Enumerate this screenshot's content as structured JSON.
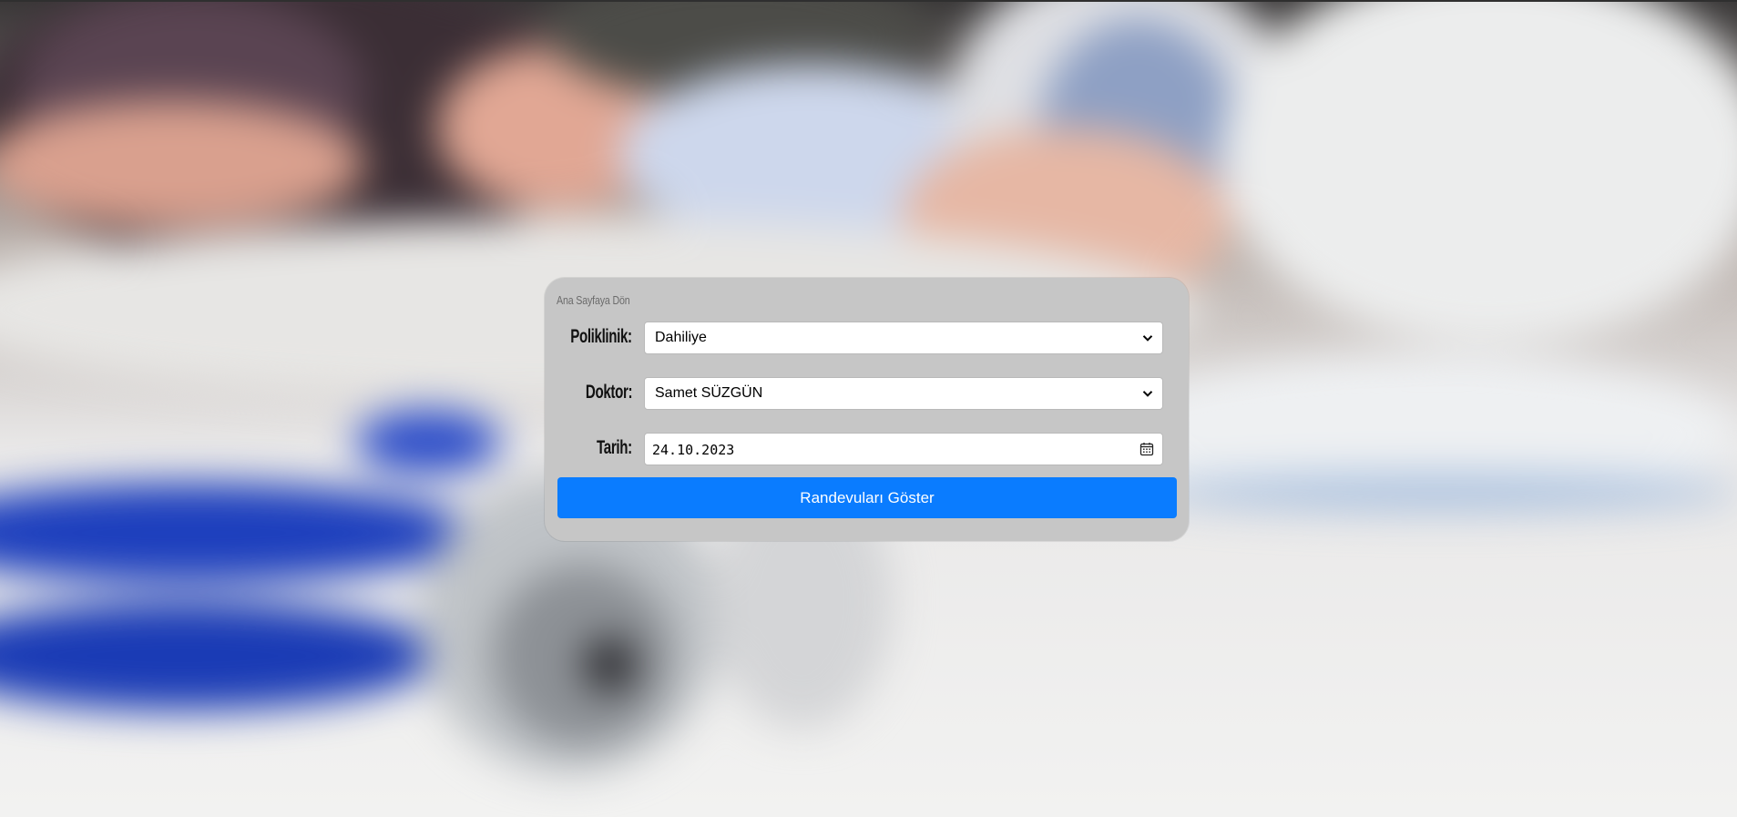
{
  "page": {
    "back_link": "Ana Sayfaya Dön"
  },
  "form": {
    "poliklinik": {
      "label": "Poliklinik:",
      "value": "Dahiliye"
    },
    "doktor": {
      "label": "Doktor:",
      "value": "Samet SÜZGÜN"
    },
    "tarih": {
      "label": "Tarih:",
      "value": "24.10.2023"
    },
    "submit_label": "Randevuları Göster"
  },
  "icons": {
    "select_arrow": "chevron-down-icon",
    "date_picker": "calendar-icon"
  },
  "colors": {
    "panel_bg": "#c6c6c6",
    "button_bg": "#0a7cff",
    "button_text": "#ffffff"
  }
}
